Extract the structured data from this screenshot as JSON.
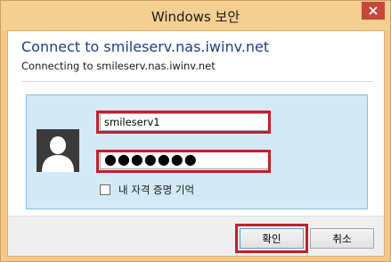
{
  "window": {
    "title": "Windows 보안"
  },
  "dialog": {
    "heading": "Connect to smileserv.nas.iwinv.net",
    "subheading": "Connecting to smileserv.nas.iwinv.net"
  },
  "credentials": {
    "username_value": "smileserv1",
    "password_value": "●●●●●●●",
    "remember_label": "내 자격 증명 기억",
    "remember_checked": false
  },
  "buttons": {
    "ok_label": "확인",
    "cancel_label": "취소"
  },
  "colors": {
    "titlebar": "#f4cf92",
    "heading_text": "#1e3f8a",
    "panel_bg": "#d3eaf6",
    "highlight": "#c2202c",
    "close_button": "#c7473b"
  },
  "icons": {
    "close": "close-icon",
    "avatar": "user-avatar-icon"
  }
}
